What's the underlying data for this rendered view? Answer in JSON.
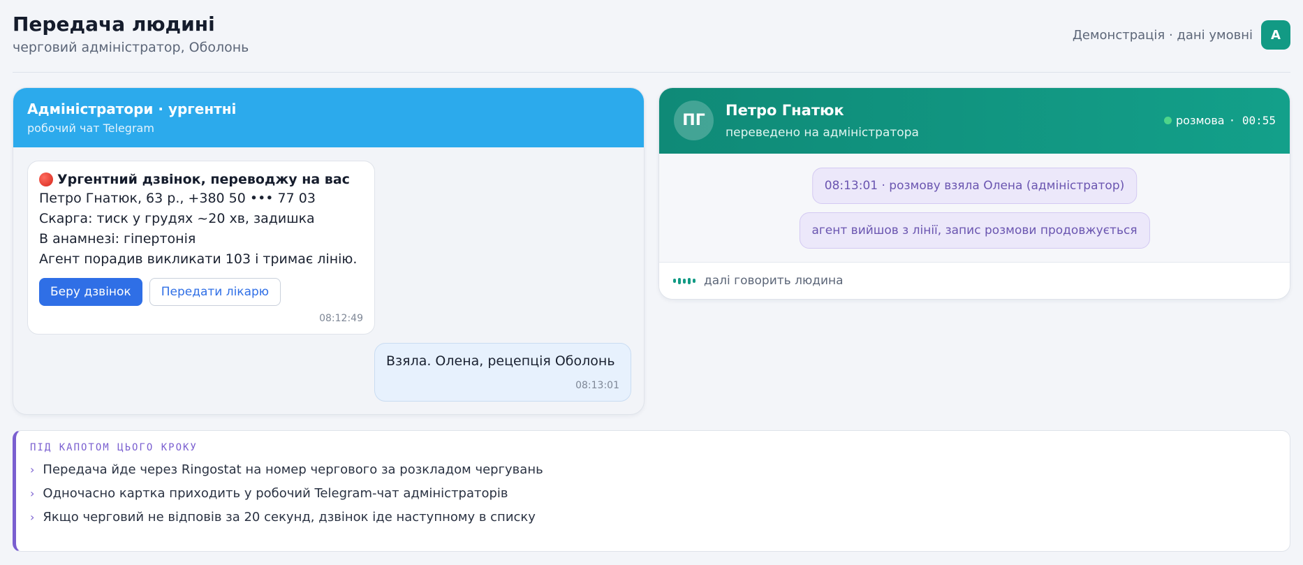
{
  "header": {
    "title": "Передача людині",
    "subtitle": "черговий адміністратор, Оболонь",
    "demo_label": "Демонстрація · дані умовні",
    "avatar_letter": "А"
  },
  "telegram": {
    "title": "Адміністратори · ургентні",
    "subtitle": "робочий чат Telegram",
    "card": {
      "title": "Ургентний дзвінок, переводжу на вас",
      "lines": [
        "Петро Гнатюк, 63 р., +380 50 ••• 77 03",
        "Скарга: тиск у грудях ~20 хв, задишка",
        "В анамнезі: гіпертонія",
        "Агент порадив викликати 103 і тримає лінію."
      ],
      "primary_button": "Беру дзвінок",
      "secondary_button": "Передати лікарю",
      "time": "08:12:49"
    },
    "reply": {
      "text": "Взяла. Олена, рецепція Оболонь",
      "time": "08:13:01"
    }
  },
  "call": {
    "avatar_initials": "ПГ",
    "name": "Петро Гнатюк",
    "subtitle": "переведено на адміністратора",
    "status_label": "розмова",
    "timer": "· 00:55",
    "system_messages": [
      "08:13:01 · розмову взяла Олена (адміністратор)",
      "агент вийшов з лінії, запис розмови продовжується"
    ],
    "footer_text": "далі говорить людина"
  },
  "under_the_hood": {
    "title": "ПІД КАПОТОМ ЦЬОГО КРОКУ",
    "items": [
      "Передача йде через Ringostat на номер чергового за розкладом чергувань",
      "Одночасно картка приходить у робочий Telegram-чат адміністраторів",
      "Якщо черговий не відповів за 20 секунд, дзвінок іде наступному в списку"
    ]
  },
  "colors": {
    "telegram_header": "#2caaec",
    "call_header": "#0f8a77",
    "accent_purple": "#7a5fd0",
    "primary_button": "#2f6fe6"
  }
}
